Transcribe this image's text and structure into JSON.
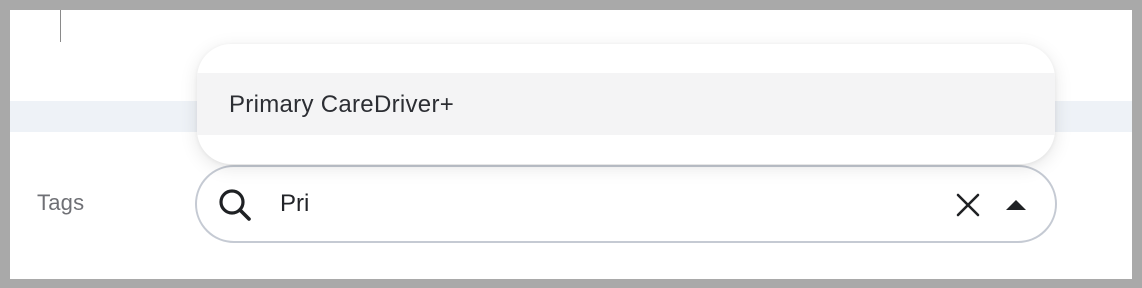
{
  "form": {
    "tags_label": "Tags"
  },
  "tags_select": {
    "search_value": "Pri",
    "icons": {
      "search": "search-icon",
      "clear": "close-icon",
      "toggle": "caret-up-icon"
    },
    "options": [
      {
        "label": "Primary CareDriver+"
      }
    ]
  },
  "colors": {
    "border": "#c5cad3",
    "option_highlight": "#f4f4f5",
    "label": "#6f7075",
    "text": "#222428",
    "band": "#eef2f7",
    "frame": "#a9a9a9"
  }
}
